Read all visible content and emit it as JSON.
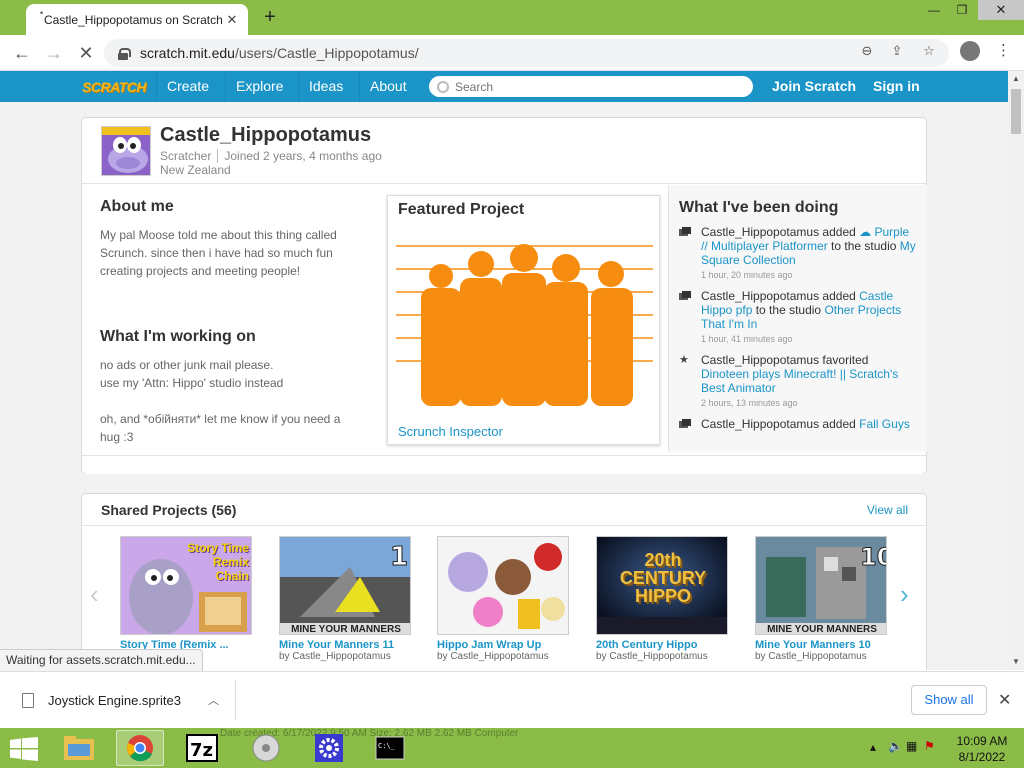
{
  "browser": {
    "tab_title": "Castle_Hippopotamus on Scratch",
    "url_host": "scratch.mit.edu",
    "url_path": "/users/Castle_Hippopotamus/",
    "status_text": "Waiting for assets.scratch.mit.edu..."
  },
  "nav": {
    "logo": "SCRATCH",
    "create": "Create",
    "explore": "Explore",
    "ideas": "Ideas",
    "about": "About",
    "search_placeholder": "Search",
    "join": "Join Scratch",
    "signin": "Sign in"
  },
  "profile": {
    "username": "Castle_Hippopotamus",
    "role": "Scratcher",
    "joined": "Joined 2 years, 4 months ago",
    "country": "New Zealand",
    "about_heading": "About me",
    "about_lines": [
      "My pal Moose told me about this thing called",
      "Scrunch. since then i have had so much fun",
      "creating projects and meeting people!"
    ],
    "working_heading": "What I'm working on",
    "working_lines": [
      "no ads or other junk mail please.",
      "use my 'Attn: Hippo' studio instead",
      "",
      "oh, and *обійняти* let me know if you need a",
      "hug :3"
    ],
    "featured_heading": "Featured Project",
    "featured_title": "Scrunch Inspector"
  },
  "activity": {
    "heading": "What I've been doing",
    "items": [
      {
        "who": "Castle_Hippopotamus",
        "verb": "added",
        "target": "☁ Purple // Multiplayer Platformer",
        "mid": "to the studio",
        "dest": "My Square Collection",
        "time": "1 hour, 20 minutes ago"
      },
      {
        "who": "Castle_Hippopotamus",
        "verb": "added",
        "target": "Castle Hippo pfp",
        "mid": "to the studio",
        "dest": "Other Projects That I'm In",
        "time": "1 hour, 41 minutes ago"
      },
      {
        "who": "Castle_Hippopotamus",
        "verb": "favorited",
        "target": "Dinoteen plays Minecraft! || Scratch's Best Animator",
        "mid": "",
        "dest": "",
        "time": "2 hours, 13 minutes ago"
      },
      {
        "who": "Castle_Hippopotamus",
        "verb": "added",
        "target": "Fall Guys",
        "mid": "",
        "dest": "",
        "time": ""
      }
    ]
  },
  "shared": {
    "title": "Shared Projects (56)",
    "view_all": "View all",
    "projects": [
      {
        "title": "Story Time (Remix ...",
        "by": "",
        "art": "Story Time Remix Chain"
      },
      {
        "title": "Mine Your Manners 11",
        "by": "by Castle_Hippopotamus",
        "art": "MINE YOUR MANNERS"
      },
      {
        "title": "Hippo Jam Wrap Up",
        "by": "by Castle_Hippopotamus",
        "art": ""
      },
      {
        "title": "20th Century Hippo",
        "by": "by Castle_Hippopotamus",
        "art": "20th CENTURY HIPPO"
      },
      {
        "title": "Mine Your Manners 10",
        "by": "by Castle_Hippopotamus",
        "art": "MINE YOUR MANNERS"
      }
    ]
  },
  "downloads": {
    "file": "Joystick Engine.sprite3",
    "show_all": "Show all",
    "ghost_text": "Date created: 6/17/2022 9:50 AM   Size: 2.62 MB                              2.62 MB                     Computer"
  },
  "taskbar": {
    "time": "10:09 AM",
    "date": "8/1/2022"
  },
  "colors": {
    "scratch_blue": "#1b95c8",
    "chrome_green": "#8cbc48",
    "featured_orange": "#f68d10"
  }
}
